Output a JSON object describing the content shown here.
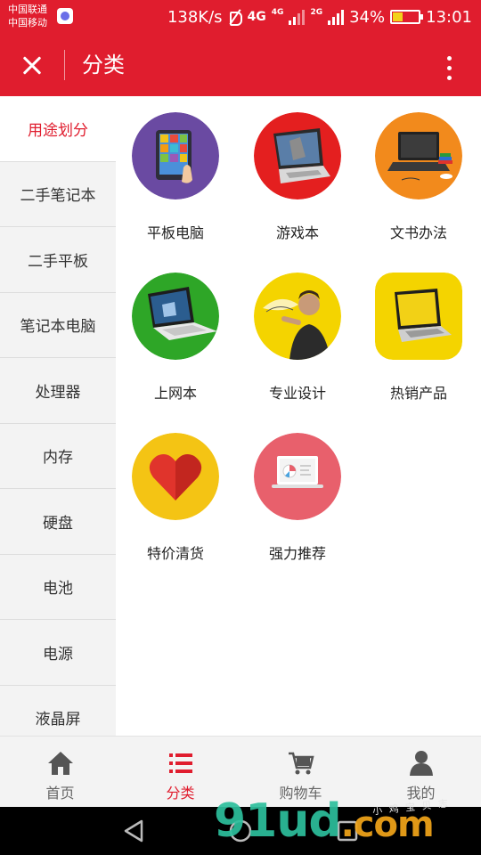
{
  "status_bar": {
    "carrier_1": "中国联通",
    "carrier_2": "中国移动",
    "net_speed": "138K/s",
    "signal_1": "4G",
    "signal_1_sub": "4G",
    "signal_2": "2G",
    "battery": "34%",
    "time": "13:01"
  },
  "header": {
    "title": "分类",
    "close_icon": "close-icon",
    "more_icon": "more-vertical-icon",
    "color": "#e01d2e"
  },
  "sidebar": {
    "items": [
      {
        "label": "用途划分",
        "active": true
      },
      {
        "label": "二手笔记本"
      },
      {
        "label": "二手平板"
      },
      {
        "label": "笔记本电脑"
      },
      {
        "label": "处理器"
      },
      {
        "label": "内存"
      },
      {
        "label": "硬盘"
      },
      {
        "label": "电池"
      },
      {
        "label": "电源"
      },
      {
        "label": "液晶屏"
      }
    ]
  },
  "categories": [
    {
      "label": "平板电脑",
      "icon": "tablet-icon",
      "color": "#6a4aa2"
    },
    {
      "label": "游戏本",
      "icon": "gaming-laptop-icon",
      "color": "#e41f1f"
    },
    {
      "label": "文书办法",
      "icon": "office-laptop-icon",
      "color": "#f28a1c"
    },
    {
      "label": "上网本",
      "icon": "netbook-icon",
      "color": "#2ea627"
    },
    {
      "label": "专业设计",
      "icon": "designer-icon",
      "color": "#f4d400"
    },
    {
      "label": "热销产品",
      "icon": "hot-laptop-icon",
      "color": "#f4d400"
    },
    {
      "label": "特价清货",
      "icon": "heart-icon",
      "color": "#f4c414"
    },
    {
      "label": "强力推荐",
      "icon": "recommend-laptop-icon",
      "color": "#e8606c"
    }
  ],
  "tab_bar": {
    "tabs": [
      {
        "label": "首页",
        "icon": "home-icon"
      },
      {
        "label": "分类",
        "icon": "list-icon",
        "active": true
      },
      {
        "label": "购物车",
        "icon": "cart-icon"
      },
      {
        "label": "我的",
        "icon": "user-icon"
      }
    ]
  },
  "nav_bar": {
    "back_icon": "back-icon",
    "home_icon": "home-circle-icon",
    "recents_icon": "recents-icon"
  },
  "watermark": {
    "text_a": "91ud",
    "text_b": ".com",
    "tag": "小 鸡 宝 贝 志"
  }
}
